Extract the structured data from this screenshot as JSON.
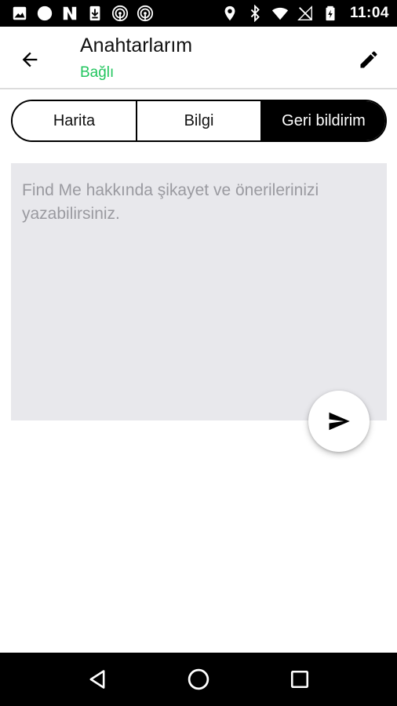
{
  "status_bar": {
    "time": "11:04",
    "left_icons": [
      "image-icon",
      "circle-icon",
      "n-icon",
      "download-icon",
      "podcast-icon",
      "podcast-icon"
    ],
    "right_icons": [
      "location-icon",
      "bluetooth-icon",
      "wifi-icon",
      "no-signal-icon",
      "battery-icon"
    ]
  },
  "app_bar": {
    "title": "Anahtarlarım",
    "subtitle": "Bağlı",
    "subtitle_color": "#22c55e"
  },
  "tabs": [
    {
      "label": "Harita",
      "active": false
    },
    {
      "label": "Bilgi",
      "active": false
    },
    {
      "label": "Geri bildirim",
      "active": true
    }
  ],
  "feedback": {
    "value": "",
    "placeholder": "Find Me hakkında şikayet ve önerilerinizi yazabilirsiniz."
  },
  "colors": {
    "accent": "#000000",
    "connected": "#22c55e",
    "input_bg": "#e8e8ec"
  }
}
